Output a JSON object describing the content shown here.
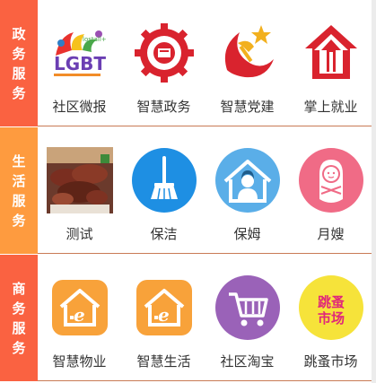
{
  "sections": [
    {
      "title": "政务服务",
      "color": "#fa6241",
      "items": [
        {
          "label": "社区微报",
          "icon": "lgbt-logo-icon"
        },
        {
          "label": "智慧政务",
          "icon": "gear-seal-icon"
        },
        {
          "label": "智慧党建",
          "icon": "party-emblem-icon"
        },
        {
          "label": "掌上就业",
          "icon": "house-arrow-icon"
        }
      ]
    },
    {
      "title": "生活服务",
      "color": "#fe9b3f",
      "items": [
        {
          "label": "测试",
          "icon": "food-photo-icon"
        },
        {
          "label": "保洁",
          "icon": "broom-icon"
        },
        {
          "label": "保姆",
          "icon": "nanny-icon"
        },
        {
          "label": "月嫂",
          "icon": "baby-icon"
        }
      ]
    },
    {
      "title": "商务服务",
      "color": "#fa6241",
      "items": [
        {
          "label": "智慧物业",
          "icon": "smart-house-icon"
        },
        {
          "label": "智慧生活",
          "icon": "smart-house-icon"
        },
        {
          "label": "社区淘宝",
          "icon": "shopping-cart-icon"
        },
        {
          "label": "跳蚤市场",
          "icon": "flea-market-icon"
        }
      ],
      "logo_text": {
        "flea_market": "跳蚤市场",
        "lgbt": "LGBT",
        "lgbt_small": "lostall+"
      }
    }
  ]
}
